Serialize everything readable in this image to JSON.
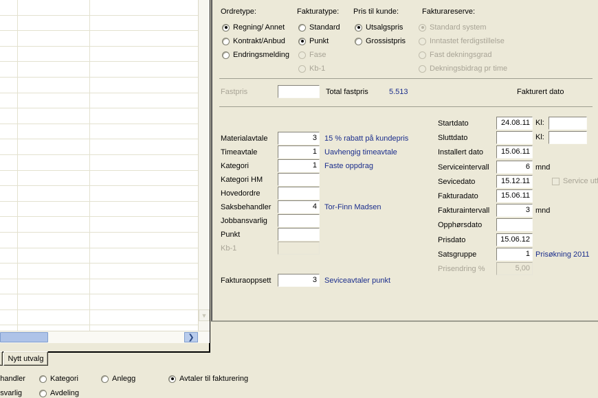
{
  "grid": {
    "row_count": 21,
    "vscroll_down_icon": "chevron-down-icon",
    "hscroll_right_icon": "chevron-right-icon"
  },
  "form": {
    "groups": {
      "ordretype": {
        "label": "Ordretype:",
        "options": [
          {
            "label": "Regning/ Annet",
            "selected": true,
            "disabled": false
          },
          {
            "label": "Kontrakt/Anbud",
            "selected": false,
            "disabled": false
          },
          {
            "label": "Endringsmelding",
            "selected": false,
            "disabled": false
          }
        ]
      },
      "fakturatype": {
        "label": "Fakturatype:",
        "options": [
          {
            "label": "Standard",
            "selected": false,
            "disabled": false
          },
          {
            "label": "Punkt",
            "selected": true,
            "disabled": false
          },
          {
            "label": "Fase",
            "selected": false,
            "disabled": true
          },
          {
            "label": "Kb-1",
            "selected": false,
            "disabled": true
          }
        ]
      },
      "pris_til_kunde": {
        "label": "Pris til kunde:",
        "options": [
          {
            "label": "Utsalgspris",
            "selected": true,
            "disabled": false
          },
          {
            "label": "Grossistpris",
            "selected": false,
            "disabled": false
          }
        ]
      },
      "fakturareserve": {
        "label": "Fakturareserve:",
        "options": [
          {
            "label": "Standard system",
            "selected": true,
            "disabled": true
          },
          {
            "label": "Inntastet ferdigstillelse",
            "selected": false,
            "disabled": true
          },
          {
            "label": "Fast dekningsgrad",
            "selected": false,
            "disabled": true
          },
          {
            "label": "Dekningsbidrag pr time",
            "selected": false,
            "disabled": true
          }
        ]
      }
    },
    "fastpris_row": {
      "fastpris_label": "Fastpris",
      "fastpris_value": "",
      "total_fastpris_label": "Total fastpris",
      "total_fastpris_value": "5.513",
      "fakturert_dato_label": "Fakturert dato"
    },
    "left_fields": [
      {
        "label": "Materialavtale",
        "value": "3",
        "note": "15 % rabatt på kundepris",
        "disabled": false
      },
      {
        "label": "Timeavtale",
        "value": "1",
        "note": "Uavhengig timeavtale",
        "disabled": false
      },
      {
        "label": "Kategori",
        "value": "1",
        "note": "Faste oppdrag",
        "disabled": false
      },
      {
        "label": "Kategori HM",
        "value": "",
        "note": "",
        "disabled": false
      },
      {
        "label": "Hovedordre",
        "value": "",
        "note": "",
        "disabled": false
      },
      {
        "label": "Saksbehandler",
        "value": "4",
        "note": "Tor-Finn Madsen",
        "disabled": false
      },
      {
        "label": "Jobbansvarlig",
        "value": "",
        "note": "",
        "disabled": false
      },
      {
        "label": "Punkt",
        "value": "",
        "note": "",
        "disabled": false
      },
      {
        "label": "Kb-1",
        "value": "",
        "note": "",
        "disabled": true
      }
    ],
    "fakturaoppsett": {
      "label": "Fakturaoppsett",
      "value": "3",
      "note": "Seviceavtaler punkt"
    },
    "right_fields": [
      {
        "label": "Startdato",
        "value": "24.08.11",
        "suffix": "",
        "extra_label": "Kl:",
        "extra_value": "",
        "disabled": false
      },
      {
        "label": "Sluttdato",
        "value": "",
        "suffix": "",
        "extra_label": "Kl:",
        "extra_value": "",
        "disabled": false
      },
      {
        "label": "Installert dato",
        "value": "15.06.11",
        "suffix": "",
        "disabled": false
      },
      {
        "label": "Serviceintervall",
        "value": "6",
        "suffix": "mnd",
        "disabled": false
      },
      {
        "label": "Sevicedato",
        "value": "15.12.11",
        "suffix": "",
        "disabled": false
      },
      {
        "label": "Fakturadato",
        "value": "15.06.11",
        "suffix": "",
        "disabled": false
      },
      {
        "label": "Fakturaintervall",
        "value": "3",
        "suffix": "mnd",
        "disabled": false
      },
      {
        "label": "Opphørsdato",
        "value": "",
        "suffix": "",
        "disabled": false
      },
      {
        "label": "Prisdato",
        "value": "15.06.12",
        "suffix": "",
        "disabled": false
      },
      {
        "label": "Satsgruppe",
        "value": "1",
        "suffix": "",
        "note": "Prisøkning 2011",
        "disabled": false
      },
      {
        "label": "Prisendring %",
        "value": "5,00",
        "suffix": "",
        "disabled": true
      }
    ],
    "service_utfort": {
      "label": "Service utfø",
      "checked": false,
      "disabled": true
    }
  },
  "bottom": {
    "buttons": [
      {
        "label": "",
        "name": "partial-button"
      },
      {
        "label": "Nytt utvalg",
        "name": "nytt-utvalg-button"
      }
    ],
    "filter_radios": [
      {
        "label": "behandler",
        "selected": false,
        "truncated": true
      },
      {
        "label": "Kategori",
        "selected": false
      },
      {
        "label": "Anlegg",
        "selected": false
      },
      {
        "label": "Avtaler til fakturering",
        "selected": true
      },
      {
        "label": "ansvarlig",
        "selected": false,
        "truncated": true
      },
      {
        "label": "Avdeling",
        "selected": false
      }
    ]
  },
  "colors": {
    "window_bg": "#ece9d8",
    "field_bg": "#ffffff",
    "link_text": "#1a2d8c",
    "disabled_text": "#a8a496",
    "scroll_thumb": "#aec3e8"
  }
}
